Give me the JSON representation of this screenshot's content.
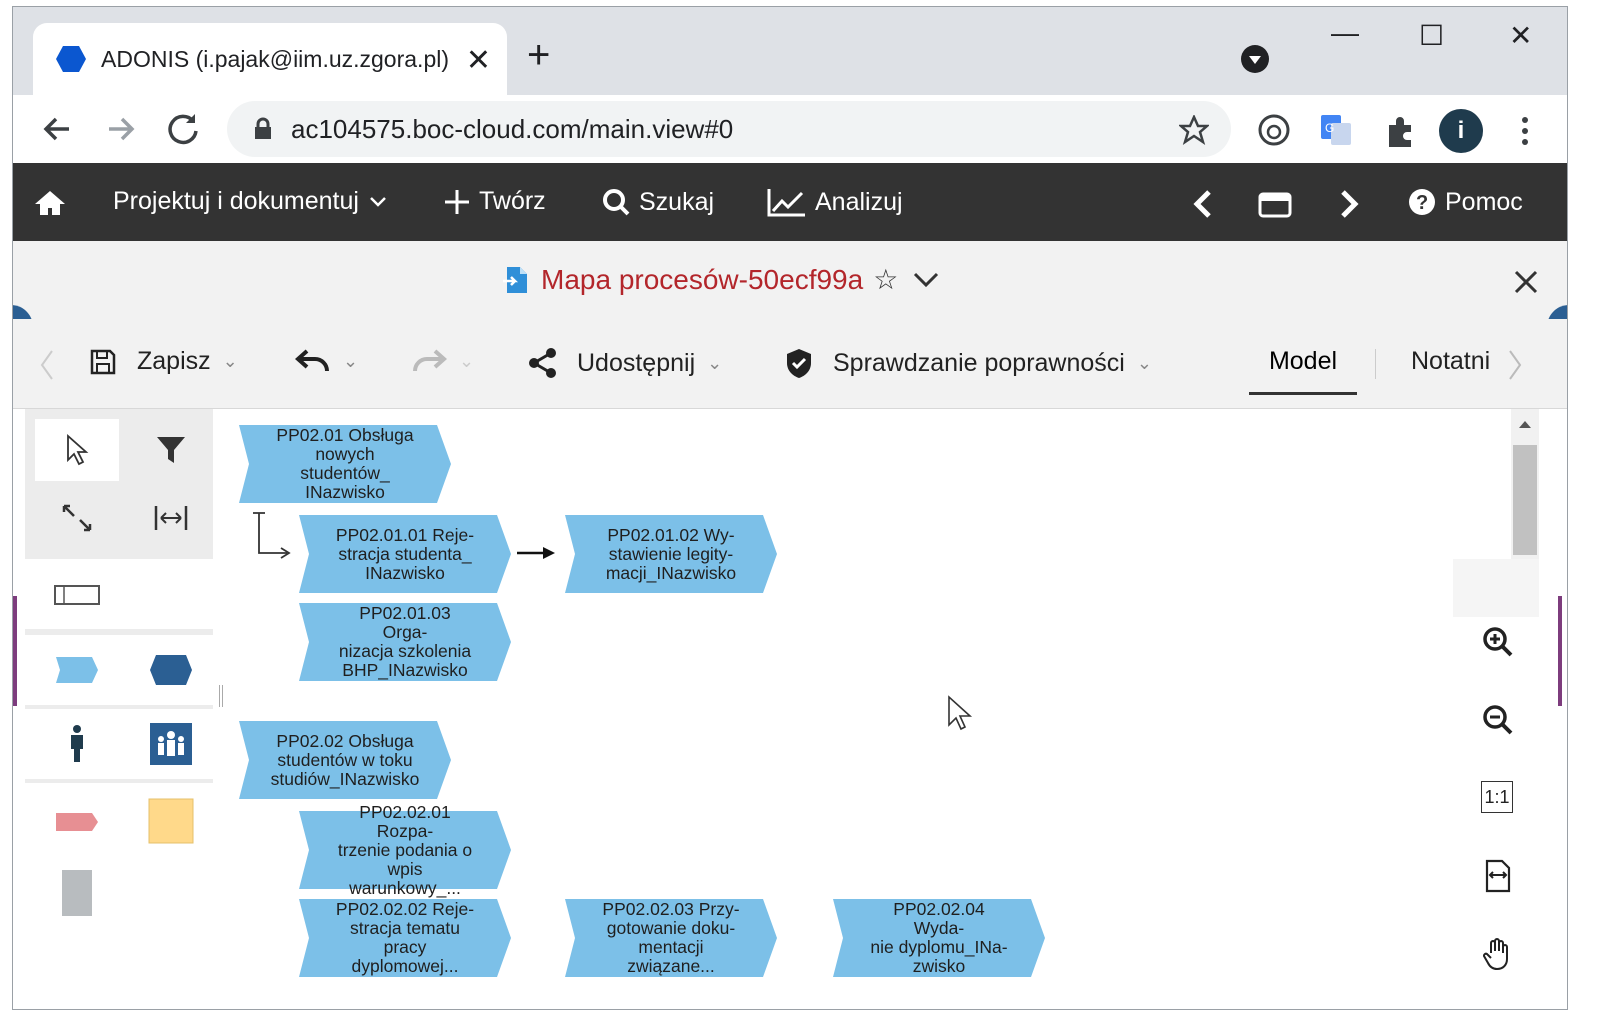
{
  "browser": {
    "tab_title": "ADONIS (i.pajak@iim.uz.zgora.pl)",
    "tab_close": "✕",
    "new_tab": "+",
    "url": "ac104575.boc-cloud.com/main.view#0",
    "avatar_letter": "i",
    "window_min": "—",
    "window_max": "☐",
    "window_close": "✕"
  },
  "appnav": {
    "design_menu": "Projektuj i dokumentuj",
    "create": "Twórz",
    "search": "Szukaj",
    "analyze": "Analizuj",
    "help": "Pomoc"
  },
  "model": {
    "title": "Mapa procesów-50ecf99a",
    "favorite_icon": "☆"
  },
  "toolbar": {
    "save": "Zapisz",
    "share": "Udostępnij",
    "validation": "Sprawdzanie poprawności",
    "tab_model": "Model",
    "tab_notes": "Notatni"
  },
  "diagram": {
    "process_1": [
      "PP02.01 Obsługa",
      "nowych studentów_",
      "INazwisko"
    ],
    "step_1_1": [
      "PP02.01.01 Reje-",
      "stracja studenta_",
      "INazwisko"
    ],
    "step_1_2": [
      "PP02.01.02 Wy-",
      "stawienie legity-",
      "macji_INazwisko"
    ],
    "step_1_3": [
      "PP02.01.03 Orga-",
      "nizacja szkolenia",
      "BHP_INazwisko"
    ],
    "process_2": [
      "PP02.02 Obsługa",
      "studentów w toku",
      "studiów_INazwisko"
    ],
    "step_2_1": [
      "PP02.02.01 Rozpa-",
      "trzenie podania o",
      "wpis warunkowy_..."
    ],
    "step_2_2": [
      "PP02.02.02 Reje-",
      "stracja tematu",
      "pracy dyplomowej..."
    ],
    "step_2_3": [
      "PP02.02.03 Przy-",
      "gotowanie doku-",
      "mentacji związane..."
    ],
    "step_2_4": [
      "PP02.02.04 Wyda-",
      "nie dyplomu_INa-",
      "zwisko"
    ]
  },
  "zoom": {
    "actual_size": "1:1"
  },
  "colors": {
    "process_fill": "#7cc0e8",
    "navbar": "#333333",
    "title_red": "#b3262b",
    "accent_blue": "#2b5f93"
  }
}
